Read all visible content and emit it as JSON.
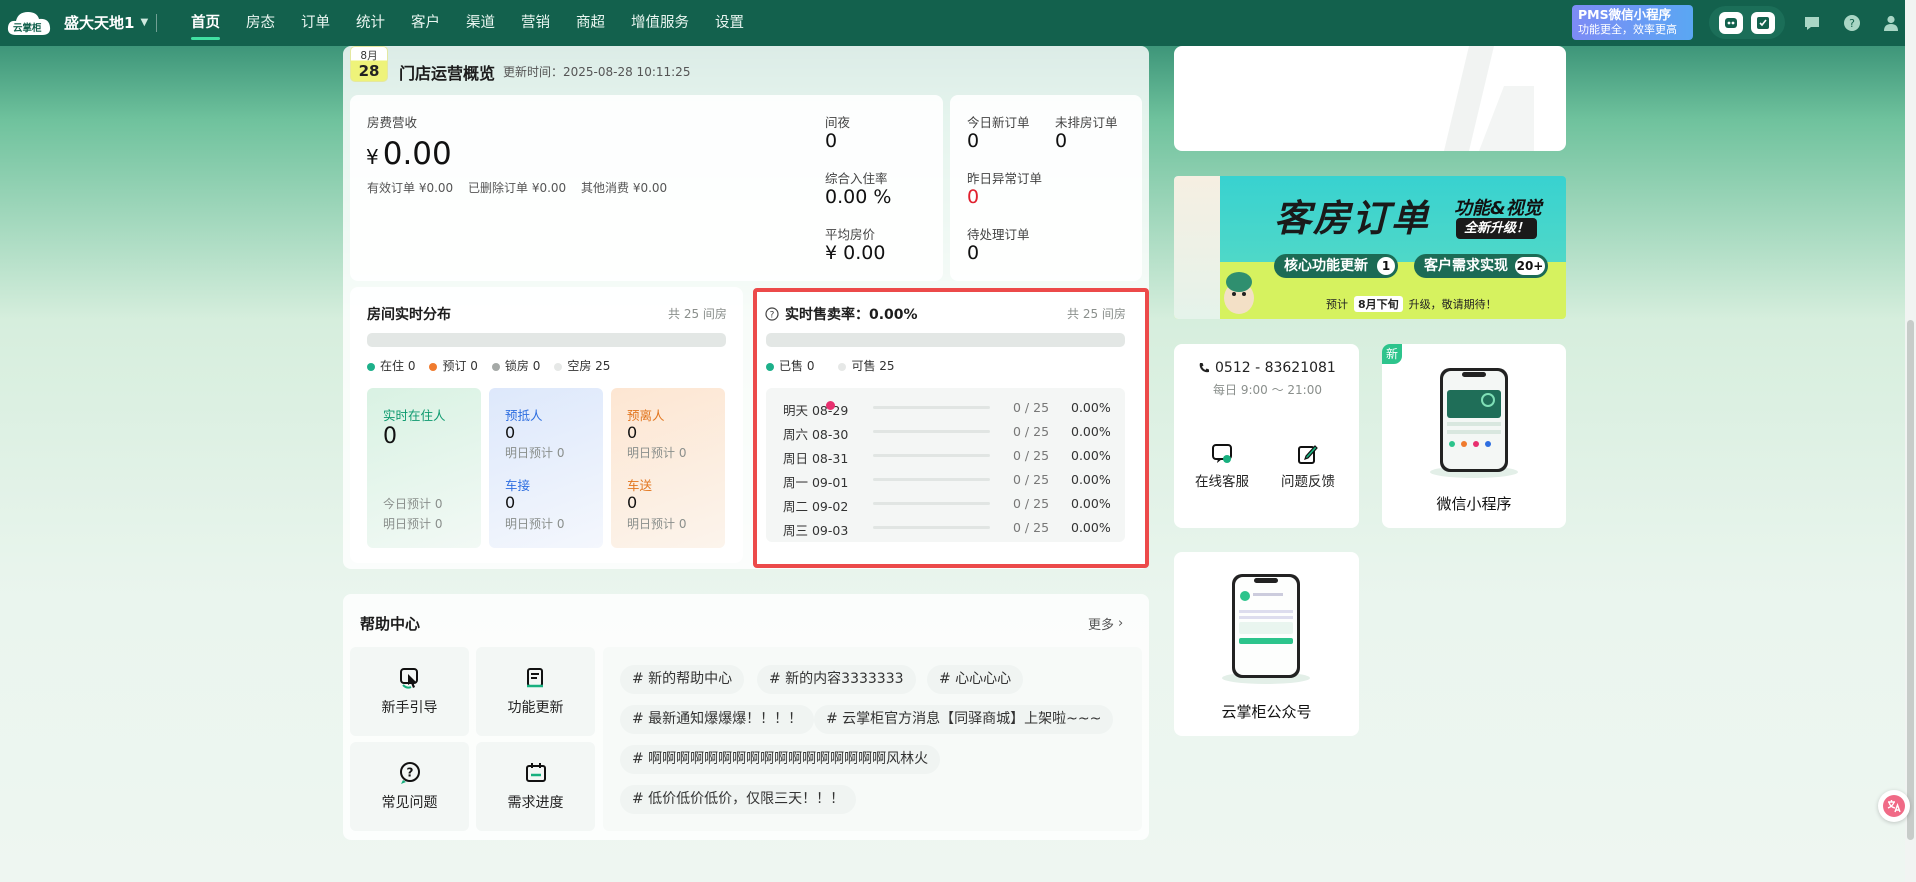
{
  "nav": {
    "brand": "云掌柜",
    "store_name": "盛大天地1",
    "menu": [
      {
        "label": "首页",
        "active": true
      },
      {
        "label": "房态"
      },
      {
        "label": "订单"
      },
      {
        "label": "统计"
      },
      {
        "label": "客户"
      },
      {
        "label": "渠道"
      },
      {
        "label": "营销"
      },
      {
        "label": "商超"
      },
      {
        "label": "增值服务"
      },
      {
        "label": "设置"
      }
    ],
    "promo_line1": "PMS微信小程序",
    "promo_line2": "功能更全，效率更高",
    "icons": [
      "robot-icon",
      "checklist-icon",
      "message-icon",
      "help-icon",
      "user-icon"
    ]
  },
  "overview": {
    "month": "8月",
    "day": "28",
    "title": "门店运营概览",
    "updated": "更新时间：2025-08-28 10:11:25",
    "revenue_label": "房费营收",
    "currency": "¥",
    "revenue_value": "0.00",
    "valid_orders": "有效订单 ¥0.00",
    "deleted_orders": "已删除订单 ¥0.00",
    "other_consumption": "其他消费 ¥0.00",
    "room_nights_label": "间夜",
    "room_nights_value": "0",
    "occupancy_label": "综合入住率",
    "occupancy_value": "0.00 %",
    "adr_label": "平均房价",
    "adr_value": "¥ 0.00",
    "new_orders_label": "今日新订单",
    "new_orders_value": "0",
    "unassigned_label": "未排房订单",
    "unassigned_value": "0",
    "abnormal_label": "昨日异常订单",
    "abnormal_value": "0",
    "pending_label": "待处理订单",
    "pending_value": "0"
  },
  "room_dist": {
    "title": "房间实时分布",
    "total": "共 25 间房",
    "legend": [
      {
        "label": "在住 0",
        "color": "#1db08a"
      },
      {
        "label": "预订 0",
        "color": "#f07b2e"
      },
      {
        "label": "锁房 0",
        "color": "#a5a9a7"
      },
      {
        "label": "空房 25",
        "color": "#e6e8e7"
      }
    ],
    "occupied_title": "实时在住人",
    "occupied_value": "0",
    "occupied_today": "今日预计 0",
    "occupied_tomorrow": "明日预计 0",
    "arrive_title": "预抵人",
    "arrive_value": "0",
    "arrive_tomorrow": "明日预计 0",
    "pickup_title": "车接",
    "pickup_value": "0",
    "pickup_tomorrow": "明日预计 0",
    "depart_title": "预离人",
    "depart_value": "0",
    "depart_tomorrow": "明日预计 0",
    "dropoff_title": "车送",
    "dropoff_value": "0",
    "dropoff_tomorrow": "明日预计 0"
  },
  "sales": {
    "title": "实时售卖率：0.00%",
    "total": "共 25 间房",
    "sold": "已售 0",
    "available": "可售 25",
    "sold_color": "#1db08a",
    "rows": [
      {
        "day": "明天 08-29",
        "count": "0 / 25",
        "pct": "0.00%",
        "fill": 0
      },
      {
        "day": "周六 08-30",
        "count": "0 / 25",
        "pct": "0.00%",
        "fill": 0
      },
      {
        "day": "周日 08-31",
        "count": "0 / 25",
        "pct": "0.00%",
        "fill": 0
      },
      {
        "day": "周一 09-01",
        "count": "0 / 25",
        "pct": "0.00%",
        "fill": 0
      },
      {
        "day": "周二 09-02",
        "count": "0 / 25",
        "pct": "0.00%",
        "fill": 0
      },
      {
        "day": "周三 09-03",
        "count": "0 / 25",
        "pct": "0.00%",
        "fill": 0
      }
    ]
  },
  "help": {
    "title": "帮助中心",
    "more": "更多",
    "tiles": [
      {
        "label": "新手引导",
        "icon": "guide-icon"
      },
      {
        "label": "功能更新",
        "icon": "update-icon"
      },
      {
        "label": "常见问题",
        "icon": "faq-icon"
      },
      {
        "label": "需求进度",
        "icon": "progress-icon"
      }
    ],
    "tags": [
      "# 新的帮助中心",
      "# 新的内容3333333",
      "# 心心心心",
      "# 最新通知爆爆爆！！！！",
      "# 云掌柜官方消息【同驿商城】上架啦~~~",
      "# 啊啊啊啊啊啊啊啊啊啊啊啊啊啊啊啊啊风林火",
      "# 低价低价低价，仅限三天！！！"
    ]
  },
  "banner": {
    "title": "客房订单",
    "sub1": "功能&视觉",
    "sub2": "全新升级！",
    "pill1": "核心功能更新",
    "pill1_num": "1",
    "pill2": "客户需求实现",
    "pill2_num": "20+",
    "footer_pre": "预计",
    "footer_highlight": "8月下旬",
    "footer_post": "升级，敬请期待！"
  },
  "contact": {
    "phone": "0512 - 83621081",
    "hours": "每日 9:00 ～ 21:00",
    "online_service": "在线客服",
    "feedback": "问题反馈"
  },
  "miniprogram": {
    "badge": "新",
    "label": "微信小程序"
  },
  "official": {
    "label": "云掌柜公众号"
  }
}
